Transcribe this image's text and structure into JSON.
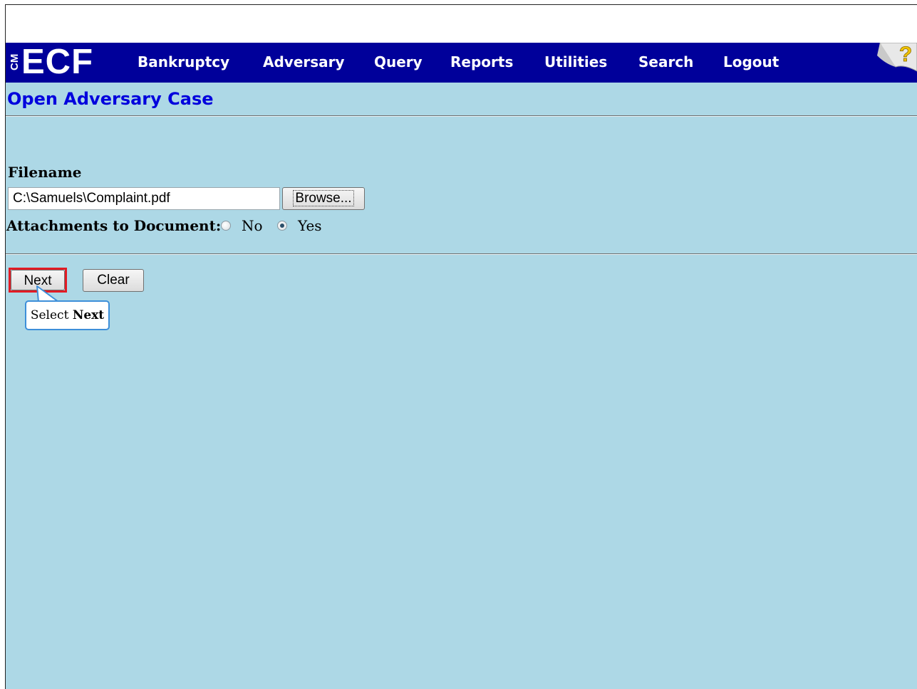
{
  "app": {
    "logo_side": "CM",
    "logo_main": "ECF"
  },
  "menu": {
    "items": [
      {
        "label": "Bankruptcy"
      },
      {
        "label": "Adversary"
      },
      {
        "label": "Query"
      },
      {
        "label": "Reports"
      },
      {
        "label": "Utilities"
      },
      {
        "label": "Search"
      },
      {
        "label": "Logout"
      }
    ],
    "help_icon": "question-mark-icon"
  },
  "page": {
    "title": "Open Adversary Case"
  },
  "form": {
    "filename_label": "Filename",
    "filename_value": "C:\\Samuels\\Complaint.pdf",
    "browse_label": "Browse...",
    "attachments_label": "Attachments to Document:",
    "attachments_options": [
      "No",
      "Yes"
    ],
    "attachments_selected": "Yes"
  },
  "actions": {
    "next_label": "Next",
    "clear_label": "Clear"
  },
  "callout": {
    "prefix": "Select ",
    "emphasis": "Next"
  },
  "colors": {
    "navbar": "#00009a",
    "content_bg": "#add8e6",
    "title": "#0000dd",
    "highlight": "#e21b24",
    "callout_border": "#3d8fd9"
  }
}
